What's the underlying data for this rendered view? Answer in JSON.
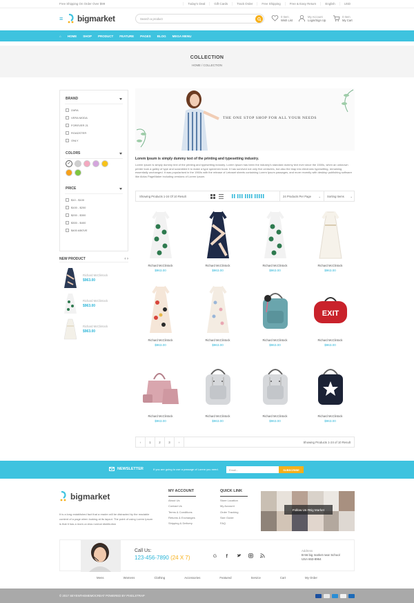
{
  "topbar": {
    "promo": "Free Shipping On Order Over $99",
    "links": [
      "Today's Deal",
      "Gift Cards",
      "Track Order",
      "Free Shipping",
      "Free & Easy Return",
      "English",
      "USD"
    ]
  },
  "header": {
    "logo": "bigmarket",
    "search_placeholder": "Search a product",
    "wishlist_count": "0 Item",
    "wishlist_label": "Wish List",
    "account_top": "My Account",
    "account_label": "Login/Sign Up",
    "cart_count": "0 Item",
    "cart_label": "My Cart"
  },
  "nav": {
    "items": [
      "HOME",
      "SHOP",
      "PRODUCT",
      "FEATURE",
      "PAGES",
      "BLOG",
      "MEGA MENU"
    ]
  },
  "hero": {
    "title": "COLLECTION",
    "breadcrumb_home": "HOME",
    "breadcrumb_sep": "/",
    "breadcrumb_current": "COLLECTION"
  },
  "sidebar": {
    "brand_title": "BRAND",
    "brands": [
      "ZARA",
      "VERA MODA",
      "FOREVER 21",
      "ROADSTER",
      "ONLY"
    ],
    "colors_title": "COLORS",
    "colors": [
      "#ffffff",
      "#cfcfcf",
      "#f4a9c0",
      "#d4a5dd",
      "#f7c31a",
      "#f7a11a",
      "#7ec641"
    ],
    "price_title": "PRICE",
    "prices": [
      "$10 - $100",
      "$100 - $200",
      "$200 - $300",
      "$300 - $400",
      "$400 ABOVE"
    ]
  },
  "new_product": {
    "title": "NEW PRODUCT",
    "items": [
      {
        "name": "Richard McClintock",
        "price": "$963.00"
      },
      {
        "name": "Richard McClintock",
        "price": "$963.00"
      },
      {
        "name": "Richard McClintock",
        "price": "$963.00"
      }
    ]
  },
  "banner": {
    "text": "THE ONE STOP SHOP FOR ALL YOUR NEEDS"
  },
  "description": {
    "title": "Lorem Ipsum is simply dummy text of the printing and typesetting industry.",
    "body": "Lorem Ipsum is simply dummy text of the printing and typesetting industry. Lorem Ipsum has been the industry's standard dummy text ever since the 1500s, when an unknown printer took a galley of type and scrambled it to make a type specimen book. It has survived not only five centuries, but also the leap into electronic typesetting, remaining essentially unchanged. It was popularised in the 1960s with the release of Letraset sheets containing Lorem Ipsum passages, and more recently with desktop publishing software like Aldus PageMaker including versions of Lorem Ipsum."
  },
  "toolbar": {
    "showing": "Showing Products 1-24 Of 10 Result",
    "per_page": "24 Products Per Page",
    "sorting": "Sorting Items"
  },
  "products": [
    {
      "name": "Richard McClintock",
      "price": "$963.00",
      "kind": "dress-green"
    },
    {
      "name": "Richard McClintock",
      "price": "$963.00",
      "kind": "dress-navy"
    },
    {
      "name": "Richard McClintock",
      "price": "$963.00",
      "kind": "dress-green"
    },
    {
      "name": "Richard McClintock",
      "price": "$963.00",
      "kind": "dress-white"
    },
    {
      "name": "Richard McClintock",
      "price": "$963.00",
      "kind": "dress-floral"
    },
    {
      "name": "Richard McClintock",
      "price": "$963.00",
      "kind": "dress-pastel"
    },
    {
      "name": "Richard McClintock",
      "price": "$963.00",
      "kind": "bag-teal"
    },
    {
      "name": "Richard McClintock",
      "price": "$963.00",
      "kind": "bag-exit"
    },
    {
      "name": "Richard McClintock",
      "price": "$963.00",
      "kind": "bag-pink"
    },
    {
      "name": "Richard McClintock",
      "price": "$963.00",
      "kind": "bag-grey"
    },
    {
      "name": "Richard McClintock",
      "price": "$963.00",
      "kind": "bag-grey"
    },
    {
      "name": "Richard McClintock",
      "price": "$963.00",
      "kind": "bag-navy"
    }
  ],
  "pagination": {
    "pages": [
      "1",
      "2",
      "3"
    ],
    "info": "Showing Products 1-24 of 10 Result"
  },
  "newsletter": {
    "label": "NEWSLETTER",
    "text": "If you are going to use a passage of Lorem you need.",
    "placeholder": "Email...",
    "button": "SUBSCRIBE"
  },
  "footer": {
    "logo": "bigmarket",
    "about": "It is a long established fact that a reader will be distracted by the readable content of a page when looking at its layout. The point of using Lorem Ipsum is that it has a more-or-less normal distribution",
    "account_title": "MY ACCOUNT",
    "account_links": [
      "About Us",
      "Contact Us",
      "Terms & Conditions",
      "Returns & Exchanges",
      "Shipping & Delivery"
    ],
    "quick_title": "QUICK LINK",
    "quick_links": [
      "Store Location",
      "My Account",
      "Order Tracking",
      "Size Guide",
      "FAQ"
    ],
    "instagram": "Follow Us #Big Market",
    "call_label": "Call Us:",
    "phone": "123-456-7890",
    "phone_hours": "(24 X 7)",
    "address_title": "Address",
    "address_line1": "B-56 big market near School",
    "address_line2": "USA 653-8964",
    "menu": [
      "Mens",
      "Womens",
      "Clothing",
      "Accessories",
      "Featured",
      "Service",
      "Cart",
      "My Order"
    ],
    "copyright": "© 2017 SEYENTHEMEMOCREAT POWERED BY PIXELSTRAP"
  },
  "accent": "#3ec3df",
  "highlight": "#f7b01a",
  "price_color": "#2bb5d8"
}
